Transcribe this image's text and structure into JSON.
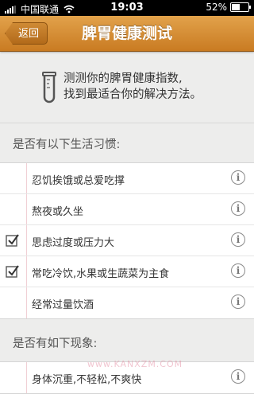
{
  "status_bar": {
    "carrier": "中国联通",
    "time": "19:03",
    "battery": "52%",
    "battery_level": 0.52
  },
  "nav": {
    "back_label": "返回",
    "title": "脾胃健康测试"
  },
  "intro": {
    "icon": "test-tube-icon",
    "line1": "测测你的脾胃健康指数,",
    "line2": "找到最适合你的解决方法。"
  },
  "section1": {
    "header": "是否有以下生活习惯:",
    "items": [
      {
        "label": "忍饥挨饿或总爱吃撑",
        "checked": false
      },
      {
        "label": "熬夜或久坐",
        "checked": false
      },
      {
        "label": "思虑过度或压力大",
        "checked": true
      },
      {
        "label": "常吃冷饮,水果或生蔬菜为主食",
        "checked": true
      },
      {
        "label": "经常过量饮酒",
        "checked": false
      }
    ]
  },
  "section2": {
    "header": "是否有如下现象:",
    "items": [
      {
        "label": "身体沉重,不轻松,不爽快",
        "checked": false
      }
    ]
  },
  "watermark": "www.KANXZM.COM",
  "colors": {
    "nav_top": "#e2a24b",
    "nav_bottom": "#c97b22",
    "background": "#ededec"
  }
}
